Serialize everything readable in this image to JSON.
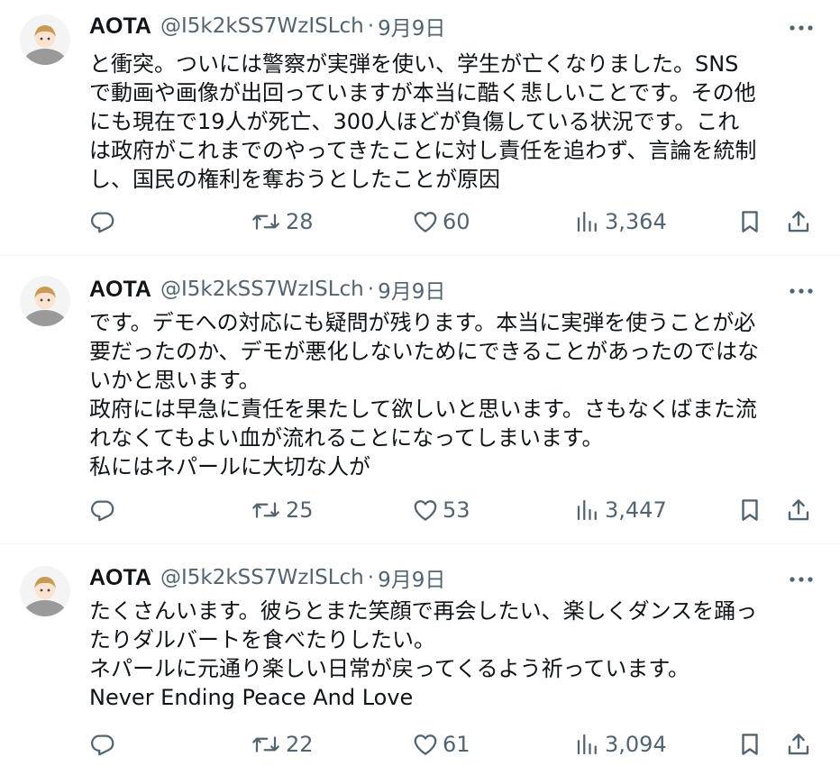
{
  "tweets": [
    {
      "display_name": "AOTA",
      "handle": "@I5k2kSS7WzISLch",
      "separator": "·",
      "date": "9月9日",
      "text_lines": [
        "と衝突。ついには警察が実弾を使い、学生が亡くなりました。SNS",
        "で動画や画像が出回っていますが本当に酷く悲しいことです。その他",
        "にも現在で19人が死亡、300人ほどが負傷している状況です。これ",
        "は政府がこれまでのやってきたことに対し責任を追わず、言論を統制",
        "し、国民の権利を奪おうとしたことが原因"
      ],
      "replies": "",
      "reposts": "28",
      "likes": "60",
      "views": "3,364"
    },
    {
      "display_name": "AOTA",
      "handle": "@I5k2kSS7WzISLch",
      "separator": "·",
      "date": "9月9日",
      "text_lines": [
        "です。デモへの対応にも疑問が残ります。本当に実弾を使うことが必",
        "要だったのか、デモが悪化しないためにできることがあったのではな",
        "いかと思います。",
        "政府には早急に責任を果たして欲しいと思います。さもなくばまた流",
        "れなくてもよい血が流れることになってしまいます。",
        "私にはネパールに大切な人が"
      ],
      "replies": "",
      "reposts": "25",
      "likes": "53",
      "views": "3,447"
    },
    {
      "display_name": "AOTA",
      "handle": "@I5k2kSS7WzISLch",
      "separator": "·",
      "date": "9月9日",
      "text_lines": [
        "たくさんいます。彼らとまた笑顔で再会したい、楽しくダンスを踊っ",
        "たりダルバートを食べたりしたい。",
        "ネパールに元通り楽しい日常が戻ってくるよう祈っています。",
        "Never Ending Peace And Love"
      ],
      "replies": "",
      "reposts": "22",
      "likes": "61",
      "views": "3,094"
    }
  ],
  "icons": {
    "reply": "reply-icon",
    "repost": "repost-icon",
    "like": "heart-icon",
    "views": "views-icon",
    "bookmark": "bookmark-icon",
    "share": "share-icon",
    "more": "more-icon",
    "avatar": "avatar-illustration"
  },
  "colors": {
    "text": "#0f1419",
    "secondary": "#536471",
    "divider": "#eff3f4",
    "background": "#ffffff"
  }
}
